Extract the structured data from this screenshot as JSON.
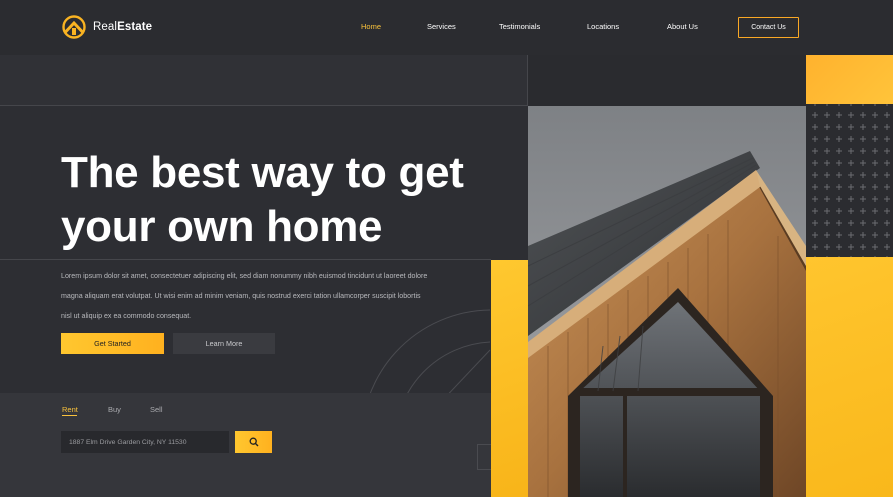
{
  "brand": {
    "name_light": "Real",
    "name_bold": "Estate"
  },
  "nav": {
    "items": [
      {
        "label": "Home",
        "active": true
      },
      {
        "label": "Services",
        "active": false
      },
      {
        "label": "Testimonials",
        "active": false
      },
      {
        "label": "Locations",
        "active": false
      },
      {
        "label": "About Us",
        "active": false
      }
    ],
    "contact_label": "Contact Us"
  },
  "hero": {
    "title_line1": "The best way to get",
    "title_line2": "your own home",
    "description_lines": [
      "Lorem ipsum dolor sit amet, consectetuer adipiscing elit, sed diam nonummy nibh euismod tincidunt ut laoreet dolore",
      "magna aliquam erat volutpat. Ut wisi enim ad minim veniam, quis nostrud exerci tation ullamcorper suscipit lobortis",
      "nisl ut aliquip ex ea commodo consequat."
    ],
    "primary_button": "Get Started",
    "secondary_button": "Learn More"
  },
  "search": {
    "tabs": [
      {
        "label": "Rent",
        "active": true
      },
      {
        "label": "Buy",
        "active": false
      },
      {
        "label": "Sell",
        "active": false
      }
    ],
    "input_value": "1887 Elm Drive Garden City, NY 11530",
    "button_icon": "search-icon"
  },
  "colors": {
    "accent": "#f9c23c",
    "accent_gradient_start": "#ffc72f",
    "accent_gradient_end": "#ffb11f",
    "background": "#2f3035",
    "header": "#2b2c30"
  }
}
